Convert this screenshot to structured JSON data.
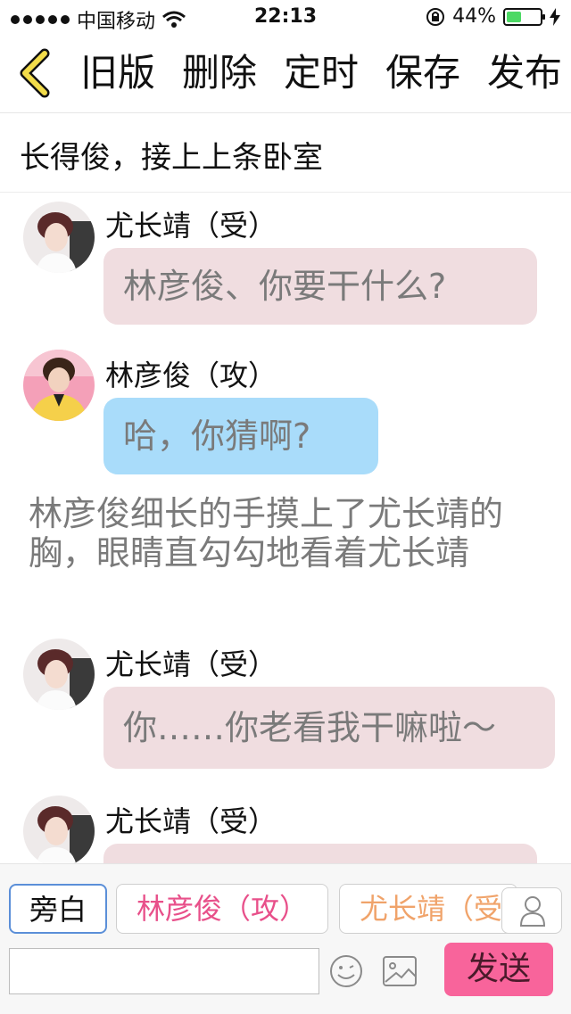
{
  "status_bar": {
    "carrier": "中国移动",
    "time": "22:13",
    "battery_percent": "44%"
  },
  "nav": {
    "old_version": "旧版",
    "delete": "删除",
    "schedule": "定时",
    "save": "保存",
    "publish": "发布"
  },
  "page_title": "长得俊，接上上条卧室",
  "messages": [
    {
      "sender": "尤长靖（受）",
      "text": "林彦俊、你要干什么?"
    },
    {
      "sender": "林彦俊（攻）",
      "text": "哈，你猜啊?"
    },
    {
      "narration": "林彦俊细长的手摸上了尤长靖的胸，眼睛直勾勾地看着尤长靖"
    },
    {
      "sender": "尤长靖（受）",
      "text": "你……你老看我干嘛啦～"
    },
    {
      "sender": "尤长靖（受）"
    }
  ],
  "bottom_bar": {
    "roles": [
      "旁白",
      "林彦俊（攻）",
      "尤长靖（受）"
    ],
    "send_label": "发送",
    "input_value": ""
  },
  "colors": {
    "pink_bubble": "#f0dde0",
    "blue_bubble": "#a9dcfa",
    "send_button": "#f8649b",
    "role_lin": "#e8508a",
    "role_you": "#f0a36a",
    "back_arrow": "#f2dc4a"
  },
  "icons": [
    "back-arrow-icon",
    "wifi-icon",
    "lock-rotation-icon",
    "battery-icon",
    "charging-icon",
    "person-icon",
    "emoji-icon",
    "image-icon"
  ]
}
